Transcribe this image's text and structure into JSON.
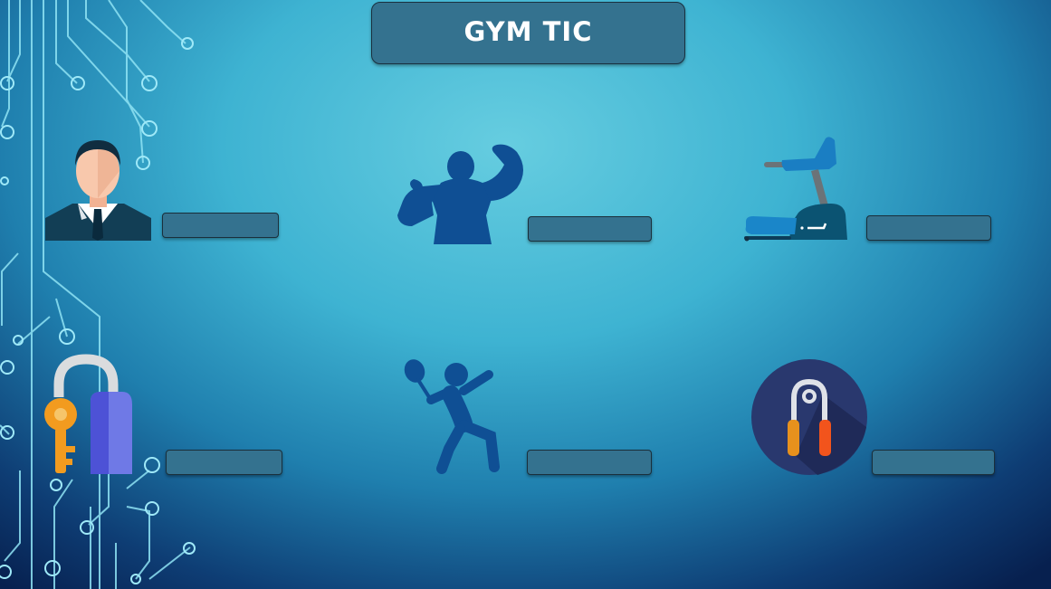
{
  "title": "GYM TIC",
  "icons": [
    {
      "name": "businessman-icon"
    },
    {
      "name": "bodybuilder-icon"
    },
    {
      "name": "treadmill-icon"
    },
    {
      "name": "padlock-key-icon"
    },
    {
      "name": "tennis-player-icon"
    },
    {
      "name": "hand-gripper-icon"
    }
  ],
  "answer_slots": [
    "",
    "",
    "",
    "",
    "",
    ""
  ],
  "colors": {
    "accent": "#34728f",
    "icon_blue": "#0f4f94"
  }
}
